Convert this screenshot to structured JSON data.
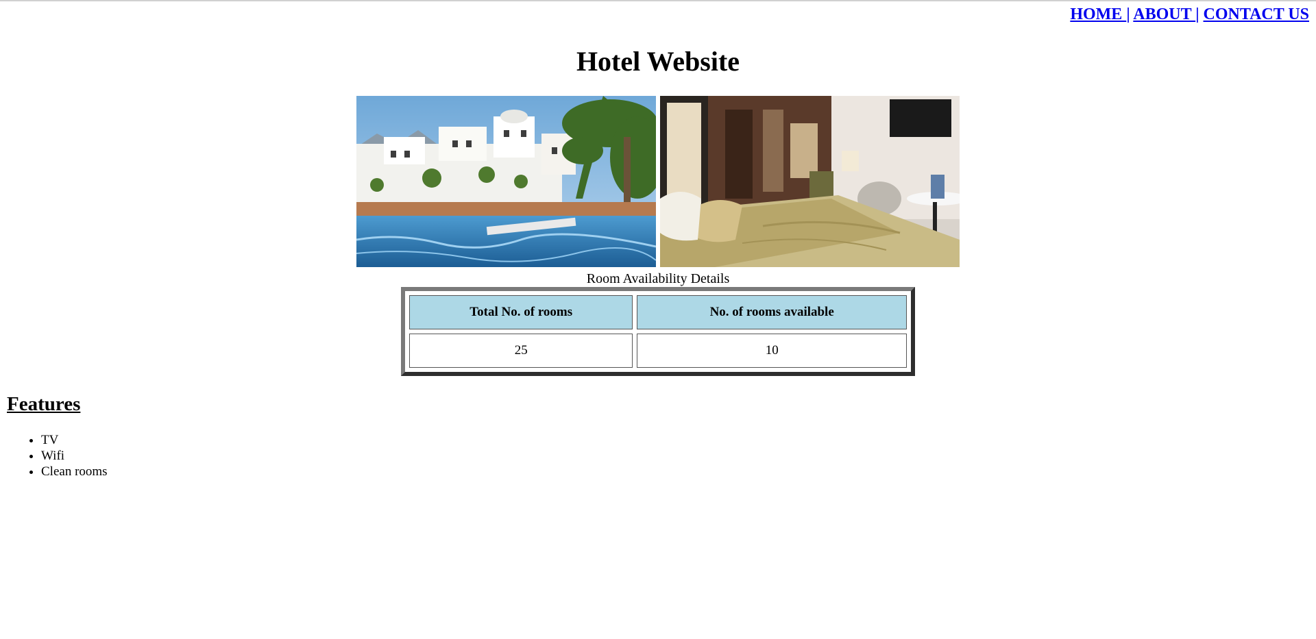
{
  "nav": {
    "items": [
      {
        "label": "HOME "
      },
      {
        "label": "ABOUT "
      },
      {
        "label": "CONTACT US"
      }
    ],
    "separator": "|"
  },
  "page_title": "Hotel Website",
  "gallery": {
    "images": [
      {
        "name": "pool-resort-photo"
      },
      {
        "name": "hotel-bedroom-photo"
      }
    ]
  },
  "availability": {
    "caption": "Room Availability Details",
    "headers": [
      "Total No. of rooms",
      "No. of rooms available"
    ],
    "values": [
      "25",
      "10"
    ],
    "header_color": "#add8e6"
  },
  "features": {
    "heading": "Features",
    "items": [
      "TV",
      "Wifi",
      "Clean rooms"
    ]
  },
  "colors": {
    "link": "#0000ee"
  }
}
